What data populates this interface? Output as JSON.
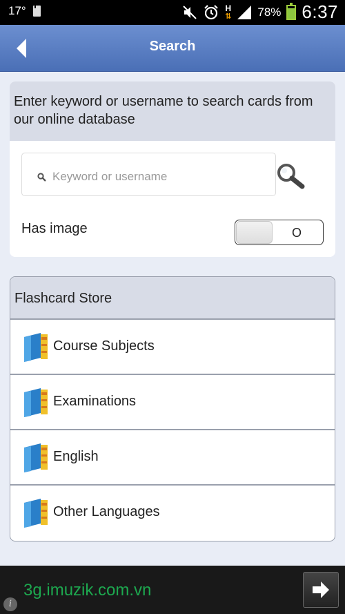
{
  "status_bar": {
    "temperature": "17°",
    "network_type": "H",
    "battery_percent": "78%",
    "battery_level": 0.78,
    "time": "6:37",
    "icons": [
      "sd-card-icon",
      "mute-icon",
      "alarm-icon",
      "data-arrows-icon",
      "signal-icon",
      "battery-icon"
    ]
  },
  "header": {
    "title": "Search",
    "back_icon": "back-arrow-icon"
  },
  "search": {
    "description": "Enter keyword or username to search cards from our online database",
    "placeholder": "Keyword or username",
    "value": "",
    "has_image_label": "Has image",
    "toggle_state": "O"
  },
  "store": {
    "title": "Flashcard Store",
    "items": [
      {
        "label": "Course Subjects",
        "icon": "book-icon"
      },
      {
        "label": "Examinations",
        "icon": "book-icon"
      },
      {
        "label": "English",
        "icon": "book-icon"
      },
      {
        "label": "Other Languages",
        "icon": "book-icon"
      }
    ]
  },
  "ad": {
    "text": "3g.imuzik.com.vn",
    "info_glyph": "i",
    "arrow_icon": "arrow-right-icon"
  },
  "colors": {
    "header_top": "#6c8fd0",
    "header_bottom": "#4a6fb6",
    "page_bg": "#e9edf6",
    "section_header_bg": "#d8dce7",
    "ad_text": "#1da84f",
    "battery": "#8cc63f"
  }
}
